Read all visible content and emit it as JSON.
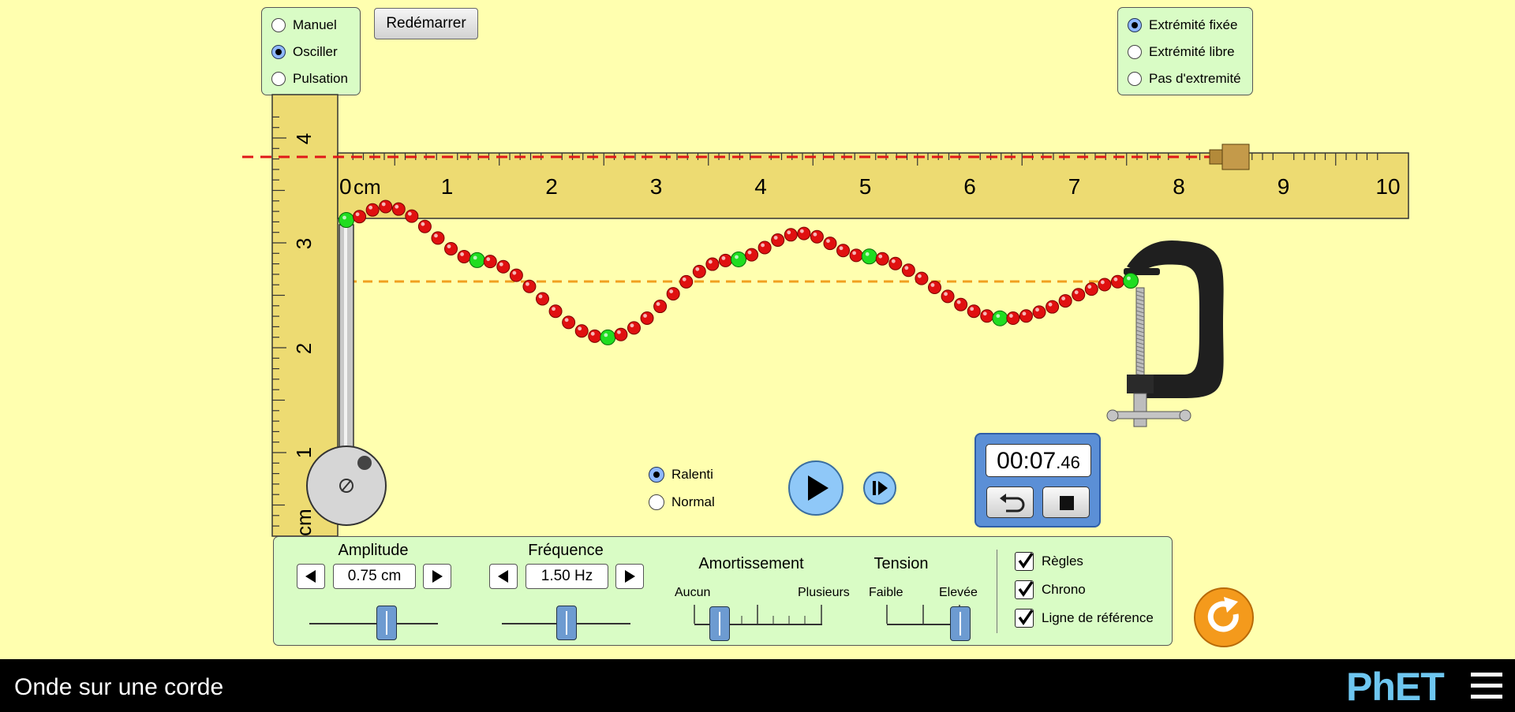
{
  "mode_panel": {
    "options": [
      {
        "label": "Manuel",
        "selected": false
      },
      {
        "label": "Osciller",
        "selected": true
      },
      {
        "label": "Pulsation",
        "selected": false
      }
    ]
  },
  "restart_label": "Redémarrer",
  "end_panel": {
    "options": [
      {
        "label": "Extrémité fixée",
        "selected": true
      },
      {
        "label": "Extrémité libre",
        "selected": false
      },
      {
        "label": "Pas d'extremité",
        "selected": false
      }
    ]
  },
  "h_ruler": {
    "unit": "cm",
    "ticks": [
      "0",
      "1",
      "2",
      "3",
      "4",
      "5",
      "6",
      "7",
      "8",
      "9",
      "10"
    ]
  },
  "v_ruler": {
    "unit": "cm",
    "ticks": [
      "1",
      "2",
      "3",
      "4"
    ]
  },
  "speed": {
    "options": [
      {
        "label": "Ralenti",
        "selected": true
      },
      {
        "label": "Normal",
        "selected": false
      }
    ]
  },
  "timer": {
    "main": "00:07",
    "fraction": ".46"
  },
  "controls": {
    "amplitude": {
      "title": "Amplitude",
      "value": "0.75 cm",
      "level": 0.6
    },
    "frequency": {
      "title": "Fréquence",
      "value": "1.50 Hz",
      "level": 0.5
    },
    "damping": {
      "title": "Amortissement",
      "min_label": "Aucun",
      "max_label": "Plusieurs",
      "level": 0.2
    },
    "tension": {
      "title": "Tension",
      "min_label": "Faible",
      "max_label": "Elevée",
      "level": 1.0
    }
  },
  "checkboxes": [
    {
      "label": "Règles",
      "checked": true
    },
    {
      "label": "Chrono",
      "checked": true
    },
    {
      "label": "Ligne de référence",
      "checked": true
    }
  ],
  "footer": {
    "title": "Onde sur une corde",
    "logo": "PhET"
  },
  "colors": {
    "background": "#ffffaf",
    "panel": "#d9fcc5",
    "bead": "#e01010",
    "bead_marked": "#20dd20",
    "reset": "#f49a1c"
  }
}
